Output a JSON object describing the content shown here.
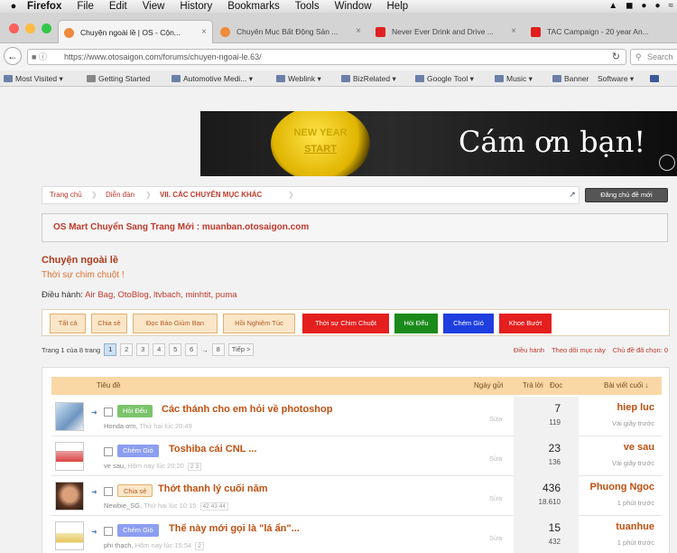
{
  "menubar": {
    "items": [
      "Firefox",
      "File",
      "Edit",
      "View",
      "History",
      "Bookmarks",
      "Tools",
      "Window",
      "Help"
    ]
  },
  "tabs": [
    {
      "label": "Chuyện ngoài lề | OS - Cộn...",
      "color": "#f08a3c"
    },
    {
      "label": "Chuyên Mục Bất Động Sản ...",
      "color": "#f08a3c"
    },
    {
      "label": "Never Ever Drink and Drive ...",
      "color": "#e02020"
    },
    {
      "label": "TAC Campaign - 20 year An...",
      "color": "#e02020"
    }
  ],
  "address": {
    "url": "https://www.otosaigon.com/forums/chuyen-ngoai-le.63/",
    "search_placeholder": "Search"
  },
  "bookmarks": [
    "Most Visited",
    "Getting Started",
    "Automotive Medi...",
    "Weblink",
    "BizRelated",
    "Google Tool",
    "Music",
    "Banner",
    "Software"
  ],
  "banner": {
    "knob_line1": "NEW YEAR",
    "knob_line2": "START",
    "message": "Cám ơn bạn!"
  },
  "breadcrumb": {
    "items": [
      "Trang chủ",
      "Diễn đàn",
      "VII. CÁC CHUYÊN MỤC KHÁC"
    ],
    "register": "Đăng chủ đề mới"
  },
  "notice": "OS Mart Chuyển Sang Trang Mới : muanban.otosaigon.com",
  "forum": {
    "title": "Chuyện ngoài lề",
    "description": "Thời sự chim chuột !",
    "mods_label": "Điều hành:",
    "mods": "Air Bag, OtoBlog, ltvbach, minhtit, puma"
  },
  "prefix_tabs": [
    {
      "label": "Tất cả",
      "bg": "#fbe6c8",
      "fg": "#b45a20"
    },
    {
      "label": "Chia sẻ",
      "bg": "#fbe6c8",
      "fg": "#b45a20"
    },
    {
      "label": "Đọc Báo Giùm Bạn",
      "bg": "#fbe6c8",
      "fg": "#b45a20"
    },
    {
      "label": "Hồi Nghiêm Túc",
      "bg": "#fbe6c8",
      "fg": "#b45a20"
    },
    {
      "label": "Thời sự Chim Chuột",
      "bg": "#e51e1e",
      "fg": "#ffffff"
    },
    {
      "label": "Hỏi Đểu",
      "bg": "#1a8a1a",
      "fg": "#ffffff"
    },
    {
      "label": "Chém Gió",
      "bg": "#1f3ee0",
      "fg": "#ffffff"
    },
    {
      "label": "Khoe Bướt",
      "bg": "#e51e1e",
      "fg": "#ffffff"
    }
  ],
  "pager": {
    "label": "Trang 1 của 8 trang",
    "pages": [
      "1",
      "2",
      "3",
      "4",
      "5",
      "6",
      "8"
    ],
    "ellipsis": "→",
    "next": "Tiếp >"
  },
  "right_links": [
    "Điều hành",
    "Theo dõi mục này",
    "Chủ đề đã chọn: 0"
  ],
  "table_head": {
    "title": "Tiêu đề",
    "date": "Ngày gửi",
    "replies": "Trả lời",
    "views": "Đọc",
    "last": "Bài viết cuối ↓"
  },
  "threads": [
    {
      "prefix": "Hỏi Đểu",
      "prefix_bg": "#7cc46c",
      "prefix_fg": "#fff",
      "title": "Các thánh cho em hỏi về photoshop",
      "author": "Honda ơm,",
      "time": "Thứ hai lúc 20:49",
      "pages": "",
      "edit": "Sửa",
      "replies": "7",
      "views": "119",
      "last_user": "hiep luc",
      "last_time": "Vài giây trước"
    },
    {
      "prefix": "Chém Gió",
      "prefix_bg": "#8c9ef0",
      "prefix_fg": "#fff",
      "title": "Toshiba cái CNL ...",
      "author": "ve sau,",
      "time": "Hôm nay lúc 20:20",
      "pages": "2 3",
      "edit": "Sửa",
      "replies": "23",
      "views": "136",
      "last_user": "ve sau",
      "last_time": "Vài giây trước"
    },
    {
      "prefix": "Chia sẻ",
      "prefix_bg": "#fbe6c8",
      "prefix_fg": "#b45a20",
      "title": "Thớt thanh lý cuối năm",
      "author": "Newbie_SG,",
      "time": "Thứ hai lúc 10:15",
      "pages": "42 43 44",
      "edit": "Sửa",
      "replies": "436",
      "views": "18.610",
      "last_user": "Phuong Ngoc",
      "last_time": "1 phút trước"
    },
    {
      "prefix": "Chém Gió",
      "prefix_bg": "#8c9ef0",
      "prefix_fg": "#fff",
      "title": "Thế này mới gọi là \"lá ẩn\"...",
      "author": "phi thạch,",
      "time": "Hôm nay lúc 15:54",
      "pages": "2",
      "edit": "Sửa",
      "replies": "15",
      "views": "432",
      "last_user": "tuanhue",
      "last_time": "1 phút trước"
    }
  ]
}
